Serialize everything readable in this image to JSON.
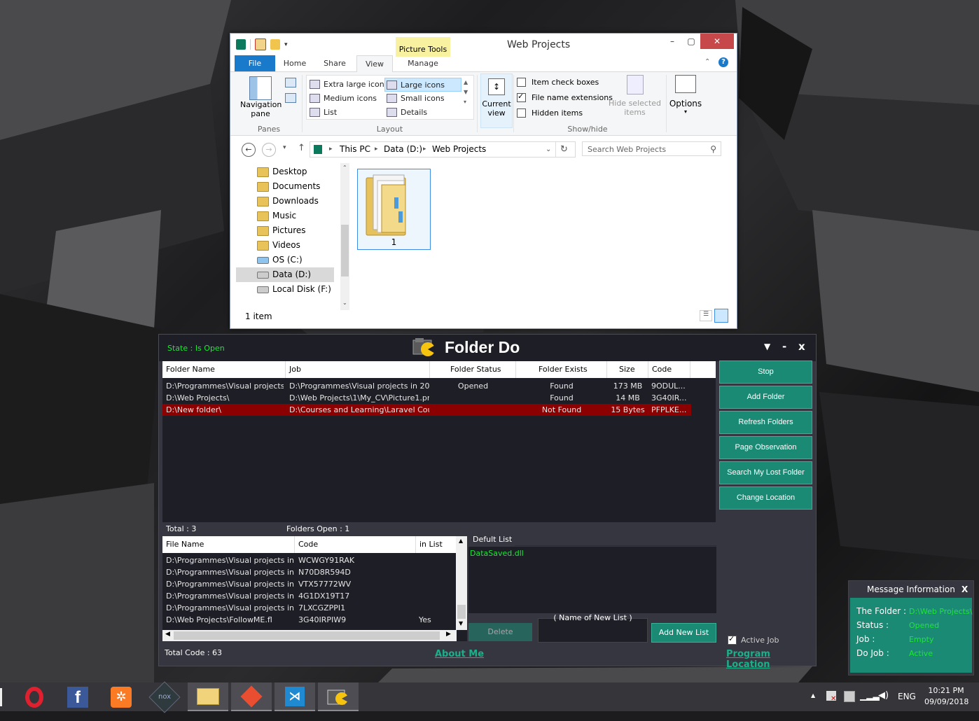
{
  "explorer": {
    "title": "Web Projects",
    "picture_tools": "Picture Tools",
    "tabs": [
      "File",
      "Home",
      "Share",
      "View",
      "Manage"
    ],
    "ribbon": {
      "nav_pane": "Navigation pane",
      "panes_group": "Panes",
      "layout_items": [
        "Extra large icons",
        "Large icons",
        "Medium icons",
        "Small icons",
        "List",
        "Details"
      ],
      "layout_group": "Layout",
      "current_view": "Current view",
      "checks": [
        "Item check boxes",
        "File name extensions",
        "Hidden items"
      ],
      "checks_state": [
        false,
        true,
        false
      ],
      "hide_selected": "Hide selected items",
      "showhide_group": "Show/hide",
      "options": "Options"
    },
    "breadcrumb": [
      "This PC",
      "Data (D:)",
      "Web Projects"
    ],
    "search_placeholder": "Search Web Projects",
    "nav_items": [
      "Desktop",
      "Documents",
      "Downloads",
      "Music",
      "Pictures",
      "Videos",
      "OS (C:)",
      "Data (D:)",
      "Local Disk (F:)"
    ],
    "file_name": "1",
    "status": "1 item"
  },
  "folderdo": {
    "state": "State : Is Open",
    "app_title": "Folder Do",
    "controls": [
      "▼",
      "-",
      "x"
    ],
    "grid_headers": [
      "Folder Name",
      "Job",
      "Folder Status",
      "Folder Exists",
      "Size",
      "Code"
    ],
    "grid_rows": [
      {
        "folder": "D:\\Programmes\\Visual projects i...",
        "job": "D:\\Programmes\\Visual projects in 201...",
        "status": "Opened",
        "exists": "Found",
        "size": "173 MB",
        "code": "9ODUL...",
        "selected": false
      },
      {
        "folder": "D:\\Web Projects\\",
        "job": "D:\\Web Projects\\1\\My_CV\\Picture1.png",
        "status": "",
        "exists": "Found",
        "size": "14 MB",
        "code": "3G40IR...",
        "selected": false
      },
      {
        "folder": "D:\\New folder\\",
        "job": "D:\\Courses and Learning\\Laravel Cour...",
        "status": "",
        "exists": "Not Found",
        "size": "15 Bytes",
        "code": "PFPLKE...",
        "selected": true
      }
    ],
    "total": "Total : 3",
    "folders_open": "Folders Open : 1",
    "file_headers": [
      "File Name",
      "Code",
      "in List"
    ],
    "file_rows": [
      {
        "name": "D:\\Programmes\\Visual projects in 2...",
        "code": "WCWGY91RAK",
        "inlist": ""
      },
      {
        "name": "D:\\Programmes\\Visual projects in 2...",
        "code": "N70D8R594D",
        "inlist": ""
      },
      {
        "name": "D:\\Programmes\\Visual projects in 2...",
        "code": "VTX57772WV",
        "inlist": ""
      },
      {
        "name": "D:\\Programmes\\Visual projects in 2...",
        "code": "4G1DX19T17",
        "inlist": ""
      },
      {
        "name": "D:\\Programmes\\Visual projects in 2...",
        "code": "7LXCGZPPI1",
        "inlist": ""
      },
      {
        "name": "D:\\Web Projects\\FollowME.fl",
        "code": "3G40IRPIW9",
        "inlist": "Yes"
      }
    ],
    "default_list_label": "Defult List :",
    "default_list_items": [
      "DataSaved.dll"
    ],
    "delete": "Delete",
    "new_list_placeholder": "( Name of New List )",
    "add_new_list": "Add New List",
    "buttons": [
      "Stop",
      "Add Folder",
      "Refresh Folders",
      "Page Observation",
      "Search My Lost Folder",
      "Change Location"
    ],
    "active_job": "Active Job",
    "active_job_checked": true,
    "total_code": "Total Code : 63",
    "about_me": "About Me",
    "program_location": "Program Location"
  },
  "message": {
    "title": "Message Information",
    "close": "X",
    "rows": [
      {
        "label": "The Folder :",
        "value": "D:\\Web Projects\\"
      },
      {
        "label": "Status :",
        "value": "Opened"
      },
      {
        "label": "Job :",
        "value": "Empty"
      },
      {
        "label": "Do Job :",
        "value": "Active"
      }
    ]
  },
  "taskbar": {
    "apps": [
      "opera-icon",
      "facebook-icon",
      "xampp-icon",
      "nox-icon",
      "file-explorer-icon",
      "git-icon",
      "visual-studio-code-icon",
      "folderdo-icon"
    ],
    "lang": "ENG",
    "time": "10:21 PM",
    "date": "09/09/2018"
  },
  "colors": {
    "accent": "#1a8a74",
    "green_text": "#22e33a",
    "selected_row": "#8b0000",
    "win_blue": "#1979ca"
  }
}
